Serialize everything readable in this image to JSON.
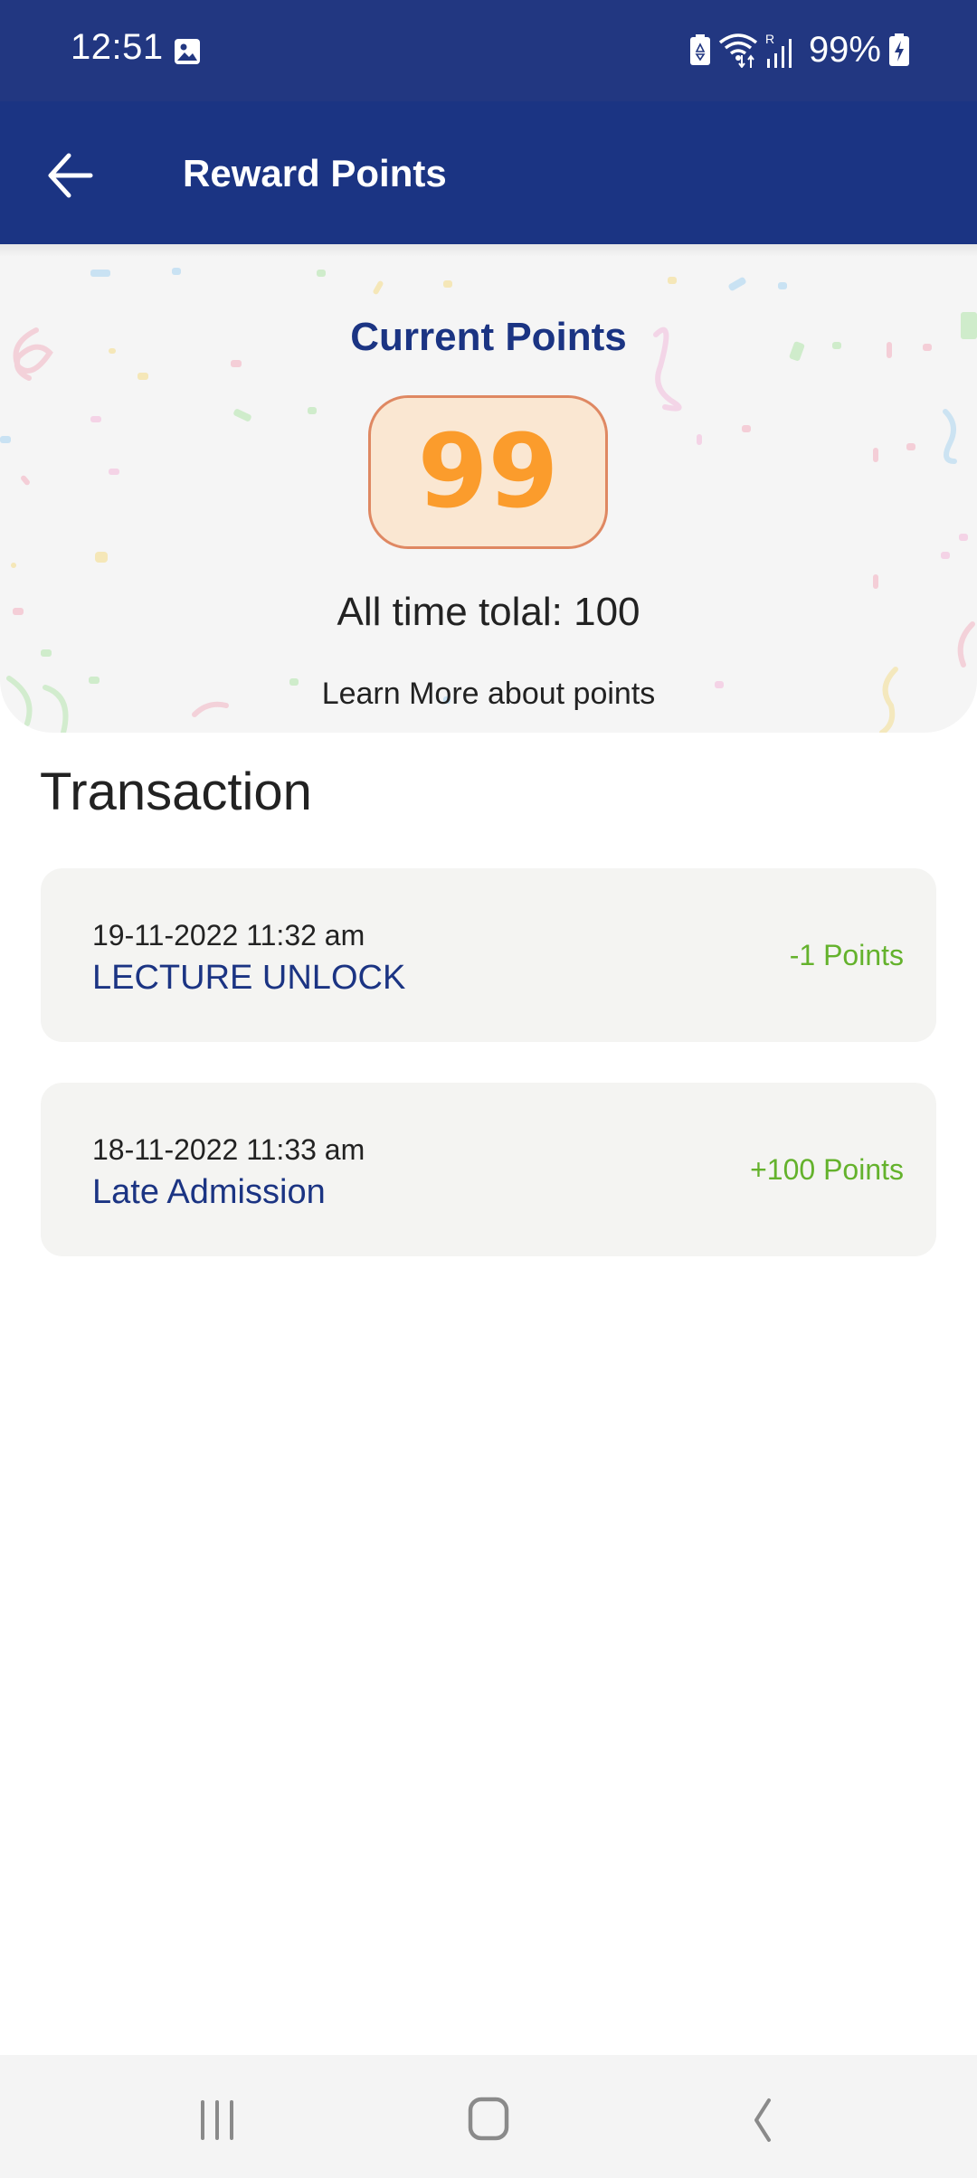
{
  "status_bar": {
    "time": "12:51",
    "battery_percent": "99%",
    "icons": [
      "gallery-icon",
      "battery-saver-icon",
      "wifi-icon",
      "signal-roaming-icon",
      "battery-charging-icon"
    ],
    "roaming_indicator": "R"
  },
  "app_bar": {
    "back_icon": "arrow-left-icon",
    "title": "Reward Points"
  },
  "points_card": {
    "label": "Current Points",
    "current_points": "99",
    "all_time_total": "All time tolal: 100",
    "learn_more_link": "Learn More about points"
  },
  "transactions": {
    "title": "Transaction",
    "items": [
      {
        "datetime": "19-11-2022 11:32 am",
        "description": "LECTURE UNLOCK",
        "points": "-1 Points"
      },
      {
        "datetime": "18-11-2022 11:33 am",
        "description": "Late Admission",
        "points": "+100 Points"
      }
    ]
  },
  "nav_bar": {
    "buttons": [
      "recent-apps-icon",
      "home-icon",
      "back-icon"
    ]
  },
  "colors": {
    "primary": "#1b3483",
    "status_bar": "#223781",
    "points_text": "#fb9c2c",
    "points_box_bg": "#fae7d2",
    "points_box_border": "#df8862",
    "positive_points": "#64b22c"
  }
}
